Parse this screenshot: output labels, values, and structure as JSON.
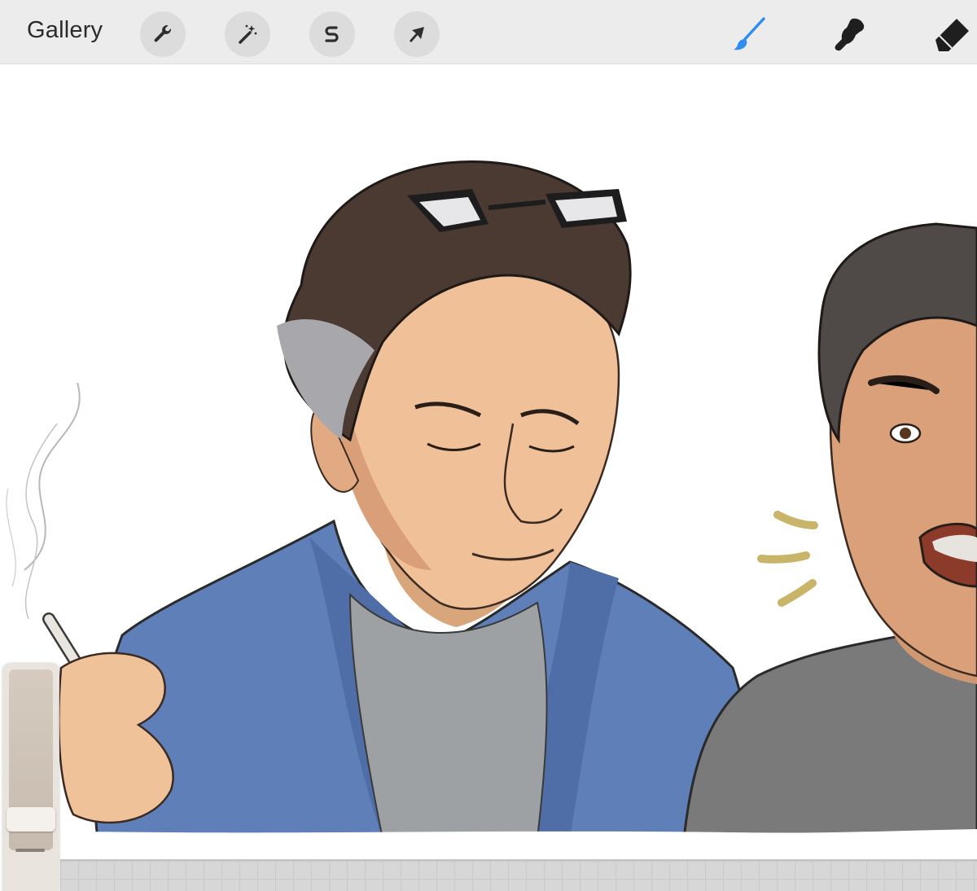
{
  "toolbar": {
    "gallery_label": "Gallery",
    "left_tools": [
      "wrench-icon",
      "magic-wand-icon",
      "selection-s-icon",
      "transform-arrow-icon"
    ],
    "right_tools": [
      "brush-icon",
      "smudge-icon",
      "eraser-icon"
    ],
    "active_tool": "brush",
    "accent_color": "#2f8df0"
  },
  "canvas": {
    "background": "#ffffff",
    "subject": "illustration"
  },
  "sidebar": {
    "sliders": [
      "brush-size-slider",
      "opacity-slider"
    ],
    "background": "#e8e2db"
  }
}
